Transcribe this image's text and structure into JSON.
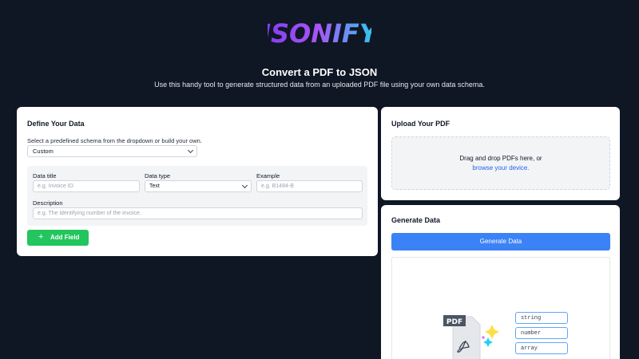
{
  "logo": {
    "text": "JSONIFY"
  },
  "header": {
    "title": "Convert a PDF to JSON",
    "subtitle": "Use this handy tool to generate structured data from an uploaded PDF file using your own data schema."
  },
  "define": {
    "title": "Define Your Data",
    "helper": "Select a predefined schema from the dropdown or build your own.",
    "schema_value": "Custom",
    "fields": {
      "title_label": "Data title",
      "title_placeholder": "e.g. Invoice ID",
      "type_label": "Data type",
      "type_value": "Text",
      "example_label": "Example",
      "example_placeholder": "e.g. B1484-B",
      "desc_label": "Description",
      "desc_placeholder": "e.g. The identifying number of the invoice."
    },
    "add_field_label": "Add Field"
  },
  "upload": {
    "title": "Upload Your PDF",
    "drop_text": "Drag and drop PDFs here, or",
    "browse_link": "browse your device."
  },
  "generate": {
    "title": "Generate Data",
    "button_label": "Generate Data",
    "illustration": {
      "pdf_label": "PDF",
      "tags": [
        "string",
        "number",
        "array"
      ]
    }
  },
  "colors": {
    "background": "#0f1624",
    "add_button": "#22c55e",
    "generate_button": "#3b82f6",
    "link": "#2563eb"
  }
}
